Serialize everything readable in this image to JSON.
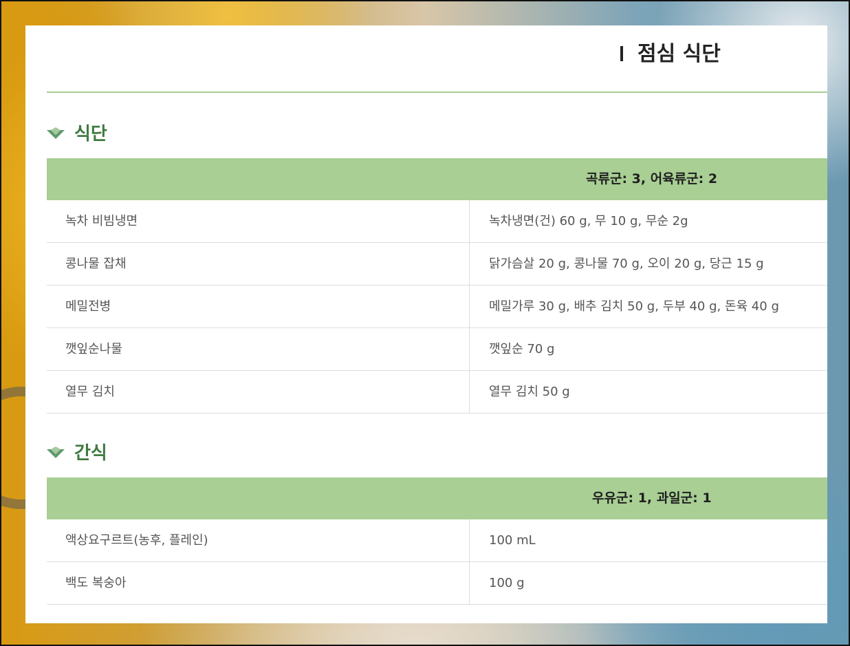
{
  "page": {
    "title": "점심 식단"
  },
  "colors": {
    "accent_green": "#a9cf94",
    "section_title_green": "#3f7a3f"
  },
  "sections": [
    {
      "title": "식단",
      "icon": "chevron-down-icon",
      "header": "곡류군: 3, 어육류군: 2",
      "rows": [
        {
          "name": "녹차 비빔냉면",
          "value": "녹차냉면(건) 60 g, 무 10 g, 무순 2g"
        },
        {
          "name": "콩나물 잡채",
          "value": "닭가슴살 20 g, 콩나물 70 g, 오이 20 g, 당근 15 g"
        },
        {
          "name": "메밀전병",
          "value": "메밀가루 30 g, 배추 김치 50 g, 두부 40 g, 돈육 40 g"
        },
        {
          "name": "깻잎순나물",
          "value": "깻잎순 70 g"
        },
        {
          "name": "열무 김치",
          "value": "열무 김치 50 g"
        }
      ]
    },
    {
      "title": "간식",
      "icon": "chevron-down-icon",
      "header": "우유군: 1, 과일군: 1",
      "rows": [
        {
          "name": "액상요구르트(농후, 플레인)",
          "value": "100 mL"
        },
        {
          "name": "백도 복숭아",
          "value": "100 g"
        }
      ]
    }
  ]
}
